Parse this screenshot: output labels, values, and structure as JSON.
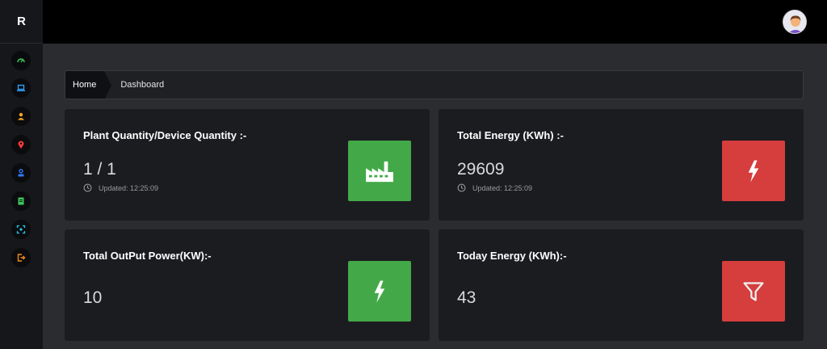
{
  "sidebar": {
    "brand": "R",
    "items": [
      {
        "icon": "gauge-icon",
        "color": "#3cc95b"
      },
      {
        "icon": "laptop-icon",
        "color": "#2fa4ff"
      },
      {
        "icon": "user-icon",
        "color": "#f6a623"
      },
      {
        "icon": "map-pin-icon",
        "color": "#ff3b3b"
      },
      {
        "icon": "user-id-icon",
        "color": "#2f7dff"
      },
      {
        "icon": "document-icon",
        "color": "#3cc95b"
      },
      {
        "icon": "scan-icon",
        "color": "#25c6e5"
      },
      {
        "icon": "logout-icon",
        "color": "#f28a1d"
      }
    ]
  },
  "header": {
    "avatar_icon": "user-avatar-icon"
  },
  "breadcrumb": {
    "home": "Home",
    "current": "Dashboard"
  },
  "cards": {
    "plant": {
      "title": "Plant Quantity/Device Quantity :-",
      "value": "1 / 1",
      "updated": "Updated: 12:25:09",
      "icon": "factory-icon",
      "color": "#43a948"
    },
    "total_energy": {
      "title": "Total Energy (KWh) :-",
      "value": "29609",
      "updated": "Updated: 12:25:09",
      "icon": "lightning-icon",
      "color": "#d63d3d"
    },
    "output_power": {
      "title": "Total OutPut Power(KW):-",
      "value": "10",
      "icon": "lightning-icon",
      "color": "#43a948"
    },
    "today_energy": {
      "title": "Today Energy (KWh):-",
      "value": "43",
      "icon": "filter-icon",
      "color": "#d63d3d"
    }
  }
}
